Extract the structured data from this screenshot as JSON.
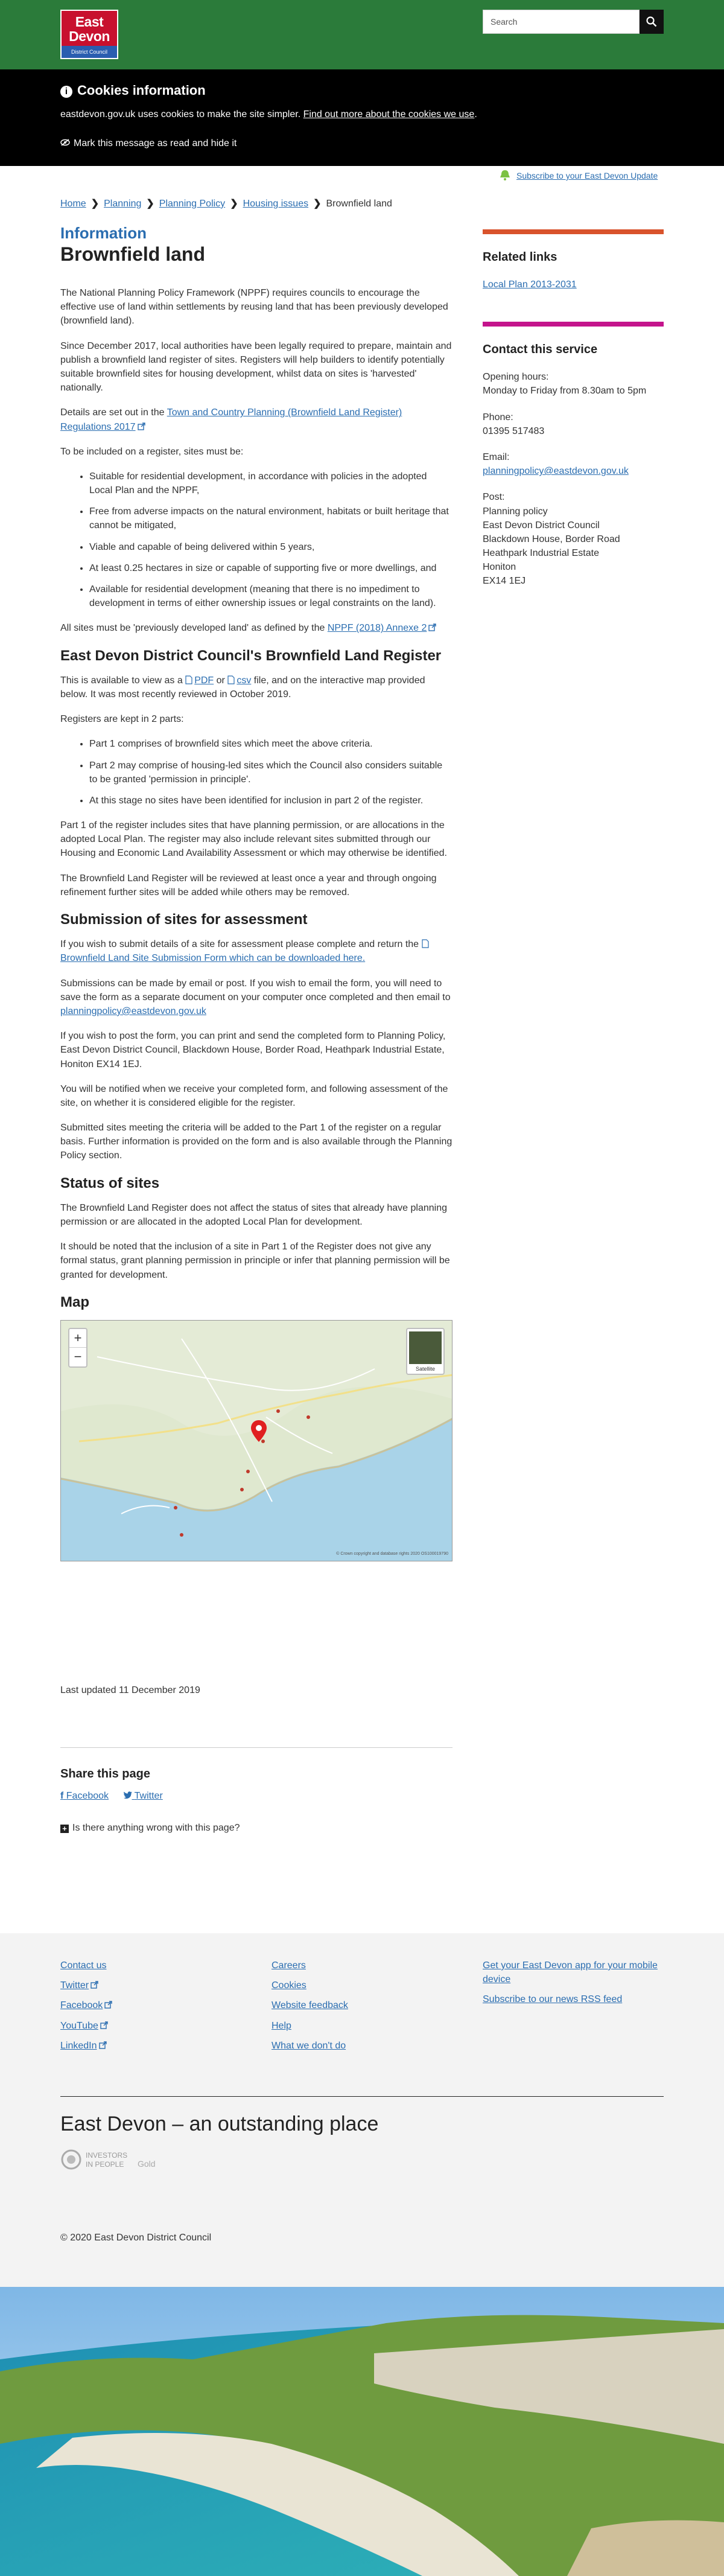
{
  "header": {
    "logo_line1": "East",
    "logo_line2": "Devon",
    "logo_sub": "District Council",
    "search_placeholder": "Search"
  },
  "cookie": {
    "title": "Cookies information",
    "text": "eastdevon.gov.uk uses cookies to make the site simpler.",
    "link": "Find out more about the cookies we use",
    "link_suffix": ".",
    "mark": "Mark this message as read and hide it"
  },
  "subscribe": "Subscribe to your East Devon Update",
  "breadcrumb": [
    "Home",
    "Planning",
    "Planning Policy",
    "Housing issues",
    "Brownfield land"
  ],
  "page": {
    "kicker": "Information",
    "title": "Brownfield land",
    "p1": "The National Planning Policy Framework (NPPF) requires councils to encourage the effective use of land within settlements by reusing land that has been previously developed (brownfield land).",
    "p2": "Since December 2017, local authorities have been legally required to prepare, maintain and publish a brownfield land register of sites. Registers will help builders to identify potentially suitable brownfield sites for housing development, whilst data on sites is 'harvested' nationally.",
    "p3_pre": "Details are set out in the ",
    "p3_link": "Town and Country Planning (Brownfield Land Register) Regulations 2017",
    "p4": "To be included on a register, sites must be:",
    "criteria": [
      "Suitable for residential development, in accordance with policies in the adopted Local Plan and the NPPF,",
      "Free from adverse impacts on the natural environment, habitats or built heritage that cannot be mitigated,",
      "Viable and capable of being delivered within 5 years,",
      "At least 0.25 hectares in size or capable of supporting five or more dwellings, and",
      "Available for residential development (meaning that there is no impediment to development in terms of either ownership issues or legal constraints on the land)."
    ],
    "p5_pre": "All sites must be 'previously developed land' as defined by the ",
    "p5_link": "NPPF (2018) Annexe 2",
    "h_register": "East Devon District Council's Brownfield Land Register",
    "p6_a": "This is available to view as a ",
    "p6_pdf": "PDF",
    "p6_b": " or ",
    "p6_csv": "csv",
    "p6_c": " file, and on the interactive map provided below. It was most recently reviewed in October 2019.",
    "p7": "Registers are kept in 2 parts:",
    "parts": [
      "Part 1 comprises of brownfield sites which meet the above criteria.",
      "Part 2 may comprise of housing-led sites which the Council also considers suitable to be granted 'permission in principle'.",
      "At this stage no sites have been identified for inclusion in part 2 of the register."
    ],
    "p8": "Part 1 of the register includes sites that have planning permission, or are allocations in the adopted Local Plan.  The register may also include relevant sites submitted through our Housing and Economic Land Availability Assessment or which may otherwise be identified.",
    "p9": "The Brownfield Land Register will be reviewed at least once a year and through ongoing refinement further sites will be added while others may be removed.",
    "h_submission": "Submission of sites for assessment",
    "p10_pre": "If you wish to submit details of a site for assessment please complete and return the ",
    "p10_link": "Brownfield Land Site Submission Form which can be downloaded here.",
    "p11_pre": "Submissions can be made by email or post. If you wish to email the form, you will need to save the form as a separate document on your computer once completed and then email to ",
    "p11_email": "planningpolicy@eastdevon.gov.uk",
    "p12": "If you wish to post the form, you can print and send the completed form to Planning Policy, East Devon District Council, Blackdown House, Border Road, Heathpark Industrial Estate, Honiton EX14 1EJ.",
    "p13": "You will be notified when we receive your completed form, and following assessment of the site, on whether it is considered eligible for the register.",
    "p14": "Submitted sites meeting the criteria will be added to the Part 1 of the register on a regular basis.  Further information is provided on the form and is also available through the Planning Policy section.",
    "h_status": "Status of sites",
    "p15": "The Brownfield Land Register does not affect the status of sites that already have planning permission or are allocated in the adopted Local Plan for development.",
    "p16": "It should be noted that the inclusion of a site in Part 1 of the Register does not give any formal status, grant planning permission in principle or infer that planning permission will be granted for development.",
    "h_map": "Map",
    "map_zoom_in": "+",
    "map_zoom_out": "−",
    "map_sat": "Satellite",
    "map_copy": "© Crown copyright and database rights 2020 OS100019790",
    "updated": "Last updated 11 December 2019",
    "share_title": "Share this page",
    "share_facebook": "Facebook",
    "share_twitter": "Twitter",
    "wrong": "Is there anything wrong with this page?"
  },
  "sidebar": {
    "related_title": "Related links",
    "related_link": "Local Plan 2013-2031",
    "contact_title": "Contact this service",
    "hours_label": "Opening hours:",
    "hours": "Monday to Friday from 8.30am to 5pm",
    "phone_label": "Phone:",
    "phone": "01395 517483",
    "email_label": "Email:",
    "email": "planningpolicy@eastdevon.gov.uk",
    "post_label": "Post:",
    "post_lines": [
      "Planning policy",
      "East Devon District Council",
      "Blackdown House, Border Road",
      "Heathpark Industrial Estate",
      "Honiton",
      "EX14 1EJ"
    ],
    "bar1_color": "#d9532c",
    "bar2_color": "#c4148c"
  },
  "footer": {
    "col1": [
      "Contact us",
      "Twitter",
      "Facebook",
      "YouTube",
      "LinkedIn"
    ],
    "col2": [
      "Careers",
      "Cookies",
      "Website feedback",
      "Help",
      "What we don't do"
    ],
    "col3": [
      "Get your East Devon app for your mobile device",
      "Subscribe to our news RSS feed"
    ],
    "tagline": "East Devon – an outstanding place",
    "iip_line1": "INVESTORS",
    "iip_line2": "IN PEOPLE",
    "iip_gold": "Gold",
    "copyright": "© 2020 East Devon District Council"
  }
}
